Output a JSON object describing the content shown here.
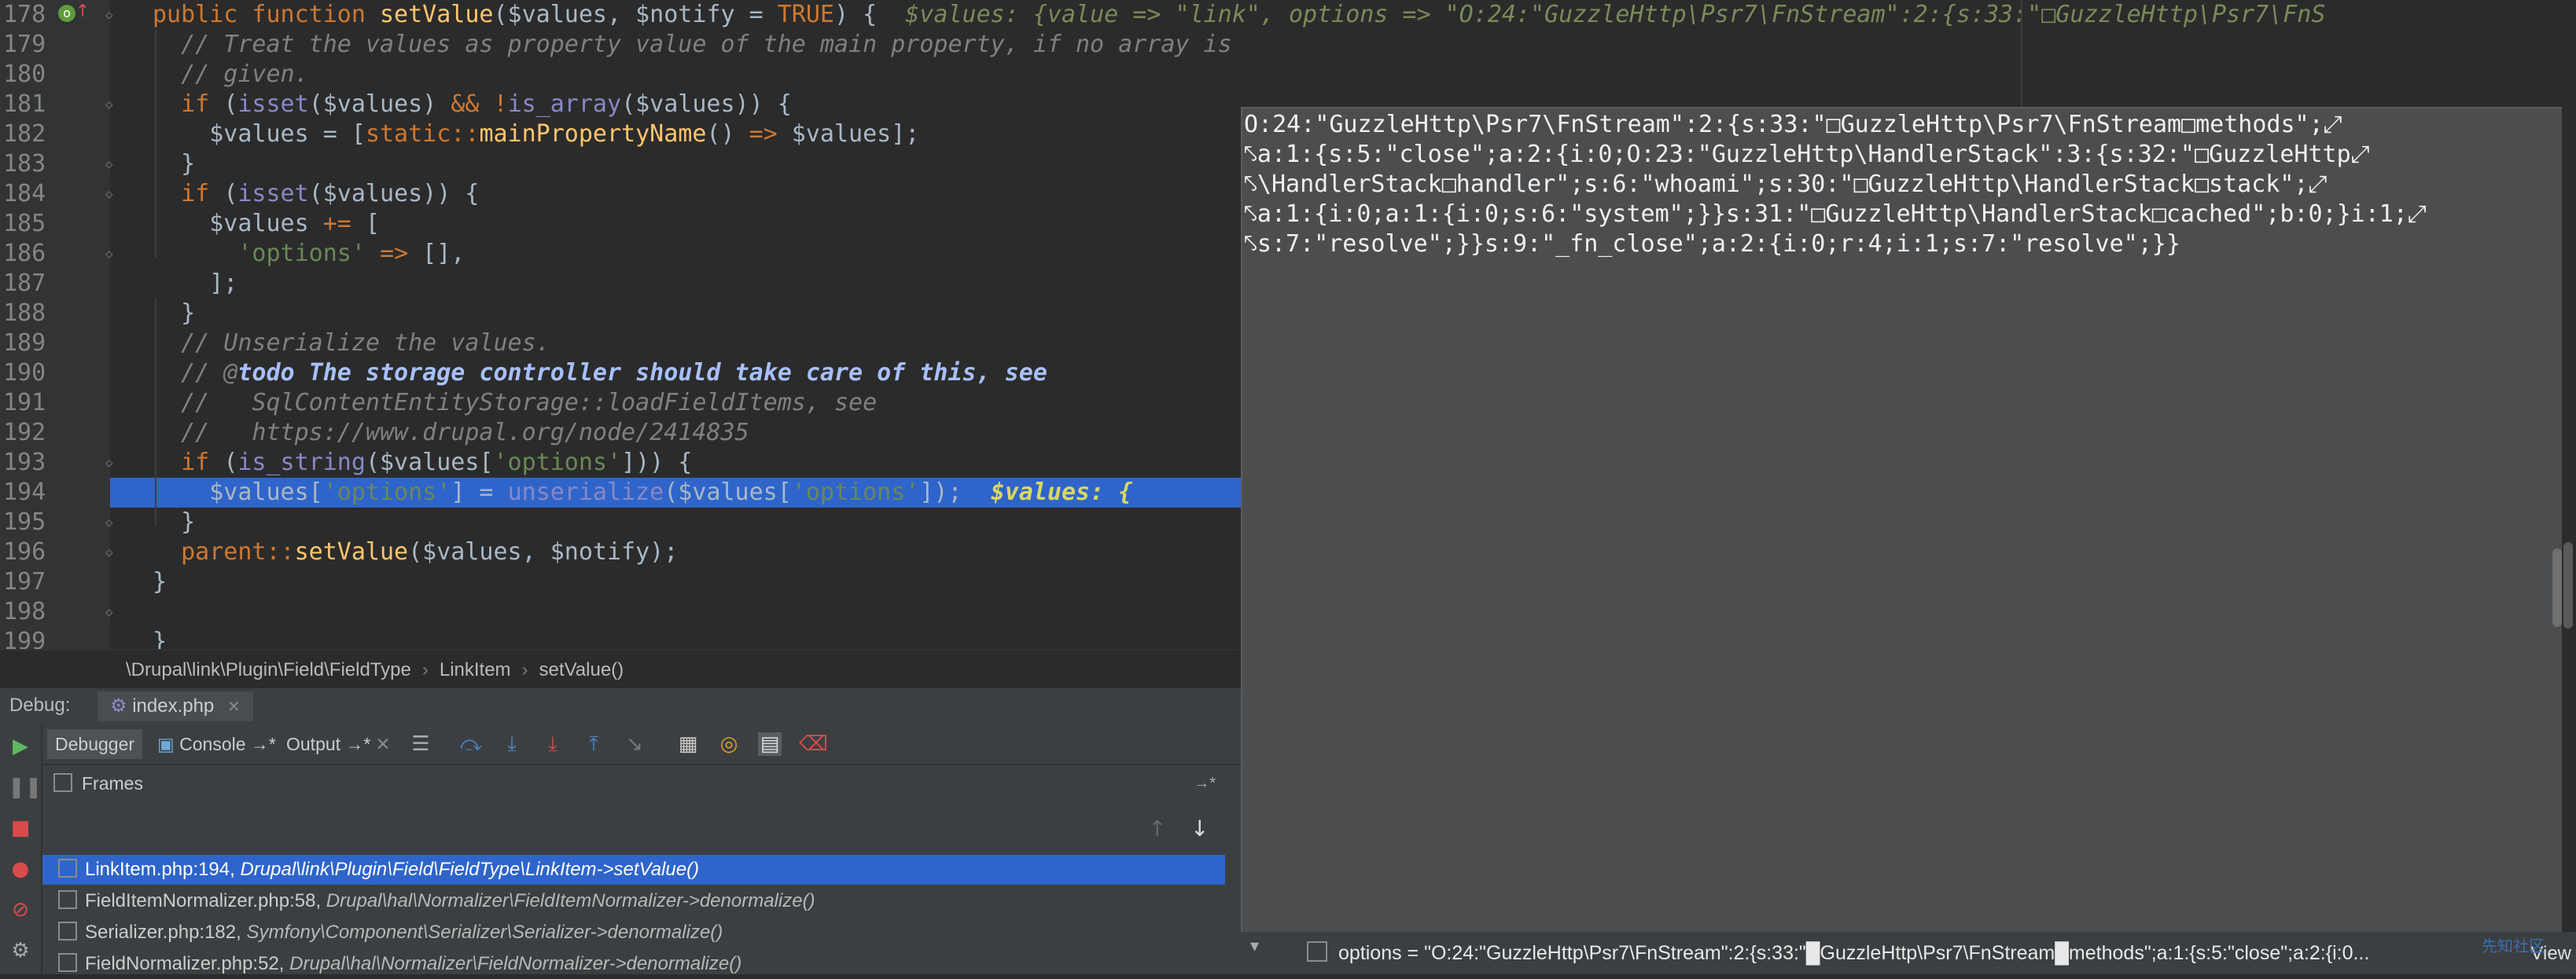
{
  "editor": {
    "lines": [
      {
        "no": "178",
        "parts": [
          {
            "c": "kw",
            "t": "public function "
          },
          {
            "c": "fn",
            "t": "setValue"
          },
          {
            "c": "var",
            "t": "($values, $notify = "
          },
          {
            "c": "kw",
            "t": "TRUE"
          },
          {
            "c": "var",
            "t": ") {  "
          },
          {
            "c": "inline",
            "t": "$values: {value => \"link\", options => \"O:24:\"GuzzleHttp\\Psr7\\FnStream\":2:{s:33:\"□GuzzleHttp\\Psr7\\FnS"
          }
        ]
      },
      {
        "no": "179",
        "parts": [
          {
            "c": "cm",
            "t": "  // Treat the values as property value of the main property, if no array is"
          }
        ]
      },
      {
        "no": "180",
        "parts": [
          {
            "c": "cm",
            "t": "  // given."
          }
        ]
      },
      {
        "no": "181",
        "parts": [
          {
            "c": "kw",
            "t": "  if "
          },
          {
            "c": "var",
            "t": "("
          },
          {
            "c": "bi",
            "t": "isset"
          },
          {
            "c": "var",
            "t": "($values) "
          },
          {
            "c": "kw",
            "t": "&& !"
          },
          {
            "c": "bi",
            "t": "is_array"
          },
          {
            "c": "var",
            "t": "($values)) {"
          }
        ]
      },
      {
        "no": "182",
        "parts": [
          {
            "c": "var",
            "t": "    $values = ["
          },
          {
            "c": "kw",
            "t": "static::"
          },
          {
            "c": "fn",
            "t": "mainPropertyName"
          },
          {
            "c": "var",
            "t": "() "
          },
          {
            "c": "kw",
            "t": "=>"
          },
          {
            "c": "var",
            "t": " $values];"
          }
        ]
      },
      {
        "no": "183",
        "parts": [
          {
            "c": "var",
            "t": "  }"
          }
        ]
      },
      {
        "no": "184",
        "parts": [
          {
            "c": "kw",
            "t": "  if "
          },
          {
            "c": "var",
            "t": "("
          },
          {
            "c": "bi",
            "t": "isset"
          },
          {
            "c": "var",
            "t": "($values)) {"
          }
        ]
      },
      {
        "no": "185",
        "parts": [
          {
            "c": "var",
            "t": "    $values "
          },
          {
            "c": "kw",
            "t": "+="
          },
          {
            "c": "var",
            "t": " ["
          }
        ]
      },
      {
        "no": "186",
        "parts": [
          {
            "c": "str",
            "t": "      'options'"
          },
          {
            "c": "kw",
            "t": " =>"
          },
          {
            "c": "var",
            "t": " [],"
          }
        ]
      },
      {
        "no": "187",
        "parts": [
          {
            "c": "var",
            "t": "    ];"
          }
        ]
      },
      {
        "no": "188",
        "parts": [
          {
            "c": "var",
            "t": "  }"
          }
        ]
      },
      {
        "no": "189",
        "parts": [
          {
            "c": "cm",
            "t": "  // Unserialize the values."
          }
        ]
      },
      {
        "no": "190",
        "parts": [
          {
            "c": "cm",
            "t": "  // @"
          },
          {
            "c": "todo",
            "t": "todo The storage controller should take care of this, see"
          }
        ]
      },
      {
        "no": "191",
        "parts": [
          {
            "c": "cm",
            "t": "  //   SqlContentEntityStorage::loadFieldItems, see"
          }
        ]
      },
      {
        "no": "192",
        "parts": [
          {
            "c": "cm",
            "t": "  //   https://www.drupal.org/node/2414835"
          }
        ]
      },
      {
        "no": "193",
        "parts": [
          {
            "c": "kw",
            "t": "  if "
          },
          {
            "c": "var",
            "t": "("
          },
          {
            "c": "bi",
            "t": "is_string"
          },
          {
            "c": "var",
            "t": "($values["
          },
          {
            "c": "str",
            "t": "'options'"
          },
          {
            "c": "var",
            "t": "])) {"
          }
        ]
      },
      {
        "no": "194",
        "parts": [
          {
            "c": "var",
            "t": "    $values["
          },
          {
            "c": "str",
            "t": "'options'"
          },
          {
            "c": "var",
            "t": "] = "
          },
          {
            "c": "bi",
            "t": "unserialize"
          },
          {
            "c": "var",
            "t": "($values["
          },
          {
            "c": "str",
            "t": "'options'"
          },
          {
            "c": "var",
            "t": "]);  "
          },
          {
            "c": "inline-y",
            "t": "$values: {"
          }
        ],
        "highlight": true
      },
      {
        "no": "195",
        "parts": [
          {
            "c": "var",
            "t": "  }"
          }
        ]
      },
      {
        "no": "196",
        "parts": [
          {
            "c": "kw",
            "t": "  parent::"
          },
          {
            "c": "fn",
            "t": "setValue"
          },
          {
            "c": "var",
            "t": "($values, $notify);"
          }
        ]
      },
      {
        "no": "197",
        "parts": [
          {
            "c": "var",
            "t": "}"
          }
        ]
      },
      {
        "no": "198",
        "parts": [
          {
            "c": "var",
            "t": ""
          }
        ]
      },
      {
        "no": "199",
        "parts": [
          {
            "c": "var",
            "t": "}"
          }
        ]
      }
    ],
    "breadcrumb": [
      "\\Drupal\\link\\Plugin\\Field\\FieldType",
      "LinkItem",
      "setValue()"
    ]
  },
  "popup": {
    "lines": [
      "O:24:\"GuzzleHttp\\Psr7\\FnStream\":2:{s:33:\"□GuzzleHttp\\Psr7\\FnStream□methods\";⤢",
      "⤣a:1:{s:5:\"close\";a:2:{i:0;O:23:\"GuzzleHttp\\HandlerStack\":3:{s:32:\"□GuzzleHttp⤢",
      "⤣\\HandlerStack□handler\";s:6:\"whoami\";s:30:\"□GuzzleHttp\\HandlerStack□stack\";⤢",
      "⤣a:1:{i:0;a:1:{i:0;s:6:\"system\";}}s:31:\"□GuzzleHttp\\HandlerStack□cached\";b:0;}i:1;⤢",
      "⤣s:7:\"resolve\";}}s:9:\"_fn_close\";a:2:{i:0;r:4;i:1;s:7:\"resolve\";}}"
    ]
  },
  "debug": {
    "label": "Debug:",
    "file_tab": "index.php",
    "tabs": [
      "Debugger",
      "Console →*",
      "Output →*"
    ],
    "frames_title": "Frames",
    "frames": [
      {
        "loc": "LinkItem.php:194,",
        "fn": "Drupal\\link\\Plugin\\Field\\FieldType\\LinkItem->setValue()",
        "selected": true
      },
      {
        "loc": "FieldItemNormalizer.php:58,",
        "fn": "Drupal\\hal\\Normalizer\\FieldItemNormalizer->denormalize()",
        "selected": false
      },
      {
        "loc": "Serializer.php:182,",
        "fn": "Symfony\\Component\\Serializer\\Serializer->denormalize()",
        "selected": false
      },
      {
        "loc": "FieldNormalizer.php:52,",
        "fn": "Drupal\\hal\\Normalizer\\FieldNormalizer->denormalize()",
        "selected": false
      }
    ]
  },
  "vars": {
    "row": "options = \"O:24:\"GuzzleHttp\\Psr7\\FnStream\":2:{s:33:\"█GuzzleHttp\\Psr7\\FnStream█methods\";a:1:{s:5:\"close\";a:2:{i:0...",
    "view_link": "View",
    "watermark": "先知社区"
  },
  "colors": {
    "selection": "#2f65ca",
    "keyword": "#cc7832",
    "function": "#ffc66d",
    "string": "#6a8759",
    "comment": "#808080",
    "popup_bg": "#4b4d4f"
  }
}
